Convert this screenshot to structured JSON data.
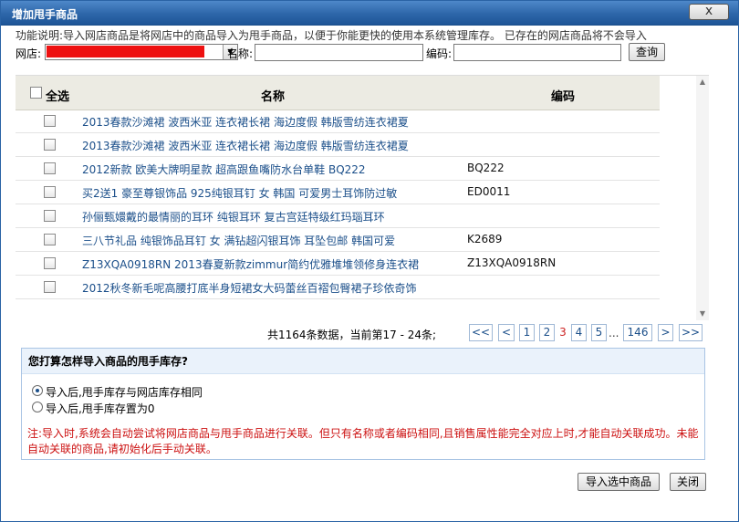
{
  "dialog": {
    "title": "增加甩手商品",
    "close_label": "x"
  },
  "description": "功能说明:导入网店商品是将网店中的商品导入为甩手商品，以便于你能更快的使用本系统管理库存。 已存在的网店商品将不会导入",
  "filters": {
    "shop_label": "网店:",
    "name_label": "名称:",
    "name_value": "",
    "code_label": "编码:",
    "code_value": "",
    "query_label": "查询"
  },
  "grid": {
    "select_all_label": "全选",
    "col_name": "名称",
    "col_code": "编码",
    "rows": [
      {
        "name": "2013春款沙滩裙 波西米亚 连衣裙长裙 海边度假 韩版雪纺连衣裙夏",
        "code": ""
      },
      {
        "name": "2013春款沙滩裙 波西米亚 连衣裙长裙 海边度假 韩版雪纺连衣裙夏",
        "code": ""
      },
      {
        "name": "2012新款 欧美大牌明星款 超高跟鱼嘴防水台单鞋 BQ222",
        "code": "BQ222"
      },
      {
        "name": "买2送1 豪至尊银饰品 925纯银耳钉 女 韩国 可爱男士耳饰防过敏",
        "code": "ED0011"
      },
      {
        "name": "孙俪甄嬛戴的最情丽的耳环 纯银耳环 复古宫廷特级红玛瑙耳环",
        "code": ""
      },
      {
        "name": "三八节礼品 纯银饰品耳钉 女 满钻超闪银耳饰 耳坠包邮 韩国可爱",
        "code": "K2689"
      },
      {
        "name": "Z13XQA0918RN 2013春夏新款zimmur简约优雅堆堆领修身连衣裙",
        "code": "Z13XQA0918RN"
      },
      {
        "name": "2012秋冬新毛呢高腰打底半身短裙女大码蕾丝百褶包臀裙子珍依奇饰",
        "code": ""
      }
    ]
  },
  "pager": {
    "info": "共1164条数据，当前第17 - 24条;",
    "first": "<<",
    "prev": "<",
    "p1": "1",
    "p2": "2",
    "p3": "3",
    "p4": "4",
    "p5": "5",
    "dots": "...",
    "last_page": "146",
    "next": ">",
    "last": ">>"
  },
  "import_options": {
    "question": "您打算怎样导入商品的甩手库存?",
    "option_same": "导入后,甩手库存与网店库存相同",
    "option_zero": "导入后,甩手库存置为0",
    "selected": "option_same",
    "note": "注:导入时,系统会自动尝试将网店商品与甩手商品进行关联。但只有名称或者编码相同,且销售属性能完全对应上时,才能自动关联成功。未能自动关联的商品,请初始化后手动关联。"
  },
  "buttons": {
    "import_selected": "导入选中商品",
    "close": "关闭"
  },
  "colors": {
    "title_bar": "#2d66a9",
    "link": "#1b4f8a",
    "current_page": "#cc2222",
    "note": "#cc1111",
    "redacted_shop": "#ee1111"
  }
}
